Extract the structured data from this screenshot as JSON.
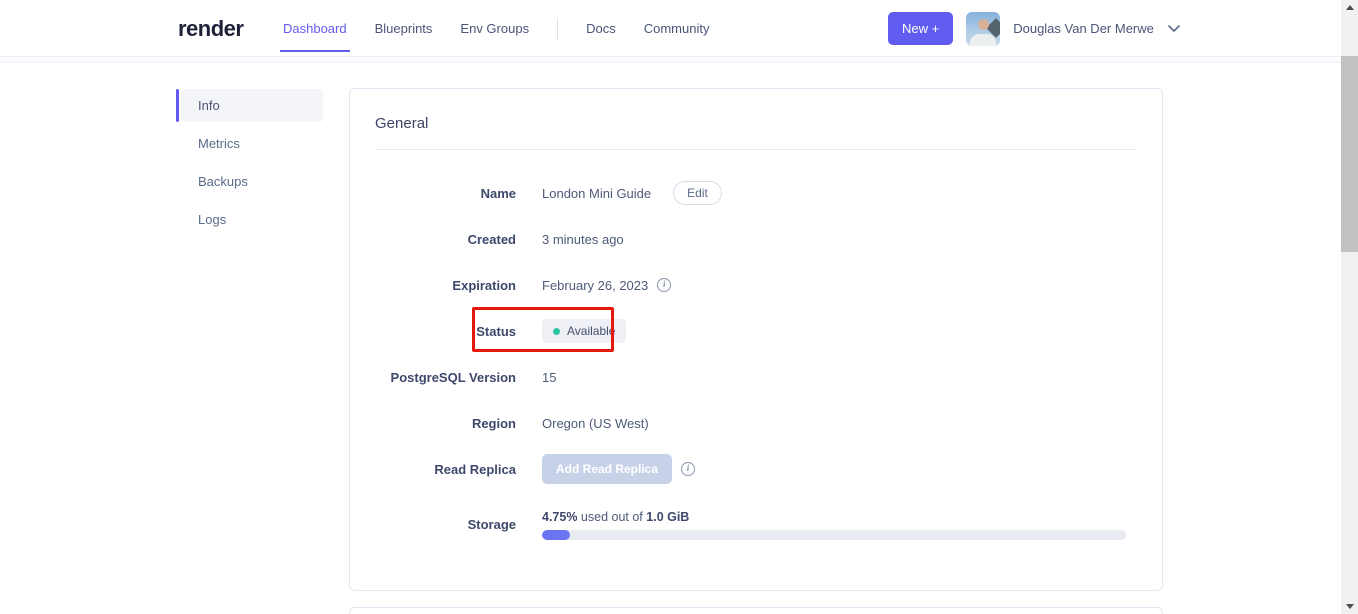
{
  "colors": {
    "accent": "#615cef",
    "logo_color": "#1e2138",
    "status_dot": "#2ec5a5",
    "annotation_red": "#e6180b",
    "progress_fill": "#6b74f1",
    "disabled_button": "#c7d2e8"
  },
  "header": {
    "logo": "render",
    "nav": [
      {
        "label": "Dashboard",
        "active": true
      },
      {
        "label": "Blueprints",
        "active": false
      },
      {
        "label": "Env Groups",
        "active": false
      },
      {
        "label": "Docs",
        "active": false
      },
      {
        "label": "Community",
        "active": false
      }
    ],
    "new_button_label": "New +",
    "user_name": "Douglas Van Der Merwe"
  },
  "sidebar": {
    "items": [
      {
        "label": "Info",
        "active": true
      },
      {
        "label": "Metrics",
        "active": false
      },
      {
        "label": "Backups",
        "active": false
      },
      {
        "label": "Logs",
        "active": false
      }
    ]
  },
  "general": {
    "title": "General",
    "name": {
      "label": "Name",
      "value": "London Mini Guide",
      "edit_button": "Edit"
    },
    "created": {
      "label": "Created",
      "value": "3 minutes ago"
    },
    "expiration": {
      "label": "Expiration",
      "value": "February 26, 2023",
      "info_glyph": "i"
    },
    "status": {
      "label": "Status",
      "badge": "Available"
    },
    "postgresql_version": {
      "label": "PostgreSQL Version",
      "value": "15"
    },
    "region": {
      "label": "Region",
      "value": "Oregon (US West)"
    },
    "read_replica": {
      "label": "Read Replica",
      "button": "Add Read Replica",
      "info_glyph": "i"
    },
    "storage": {
      "label": "Storage",
      "used_pct": "4.75%",
      "used_text": " used out of ",
      "total": "1.0 GiB",
      "progress_width": "4.75%"
    }
  }
}
